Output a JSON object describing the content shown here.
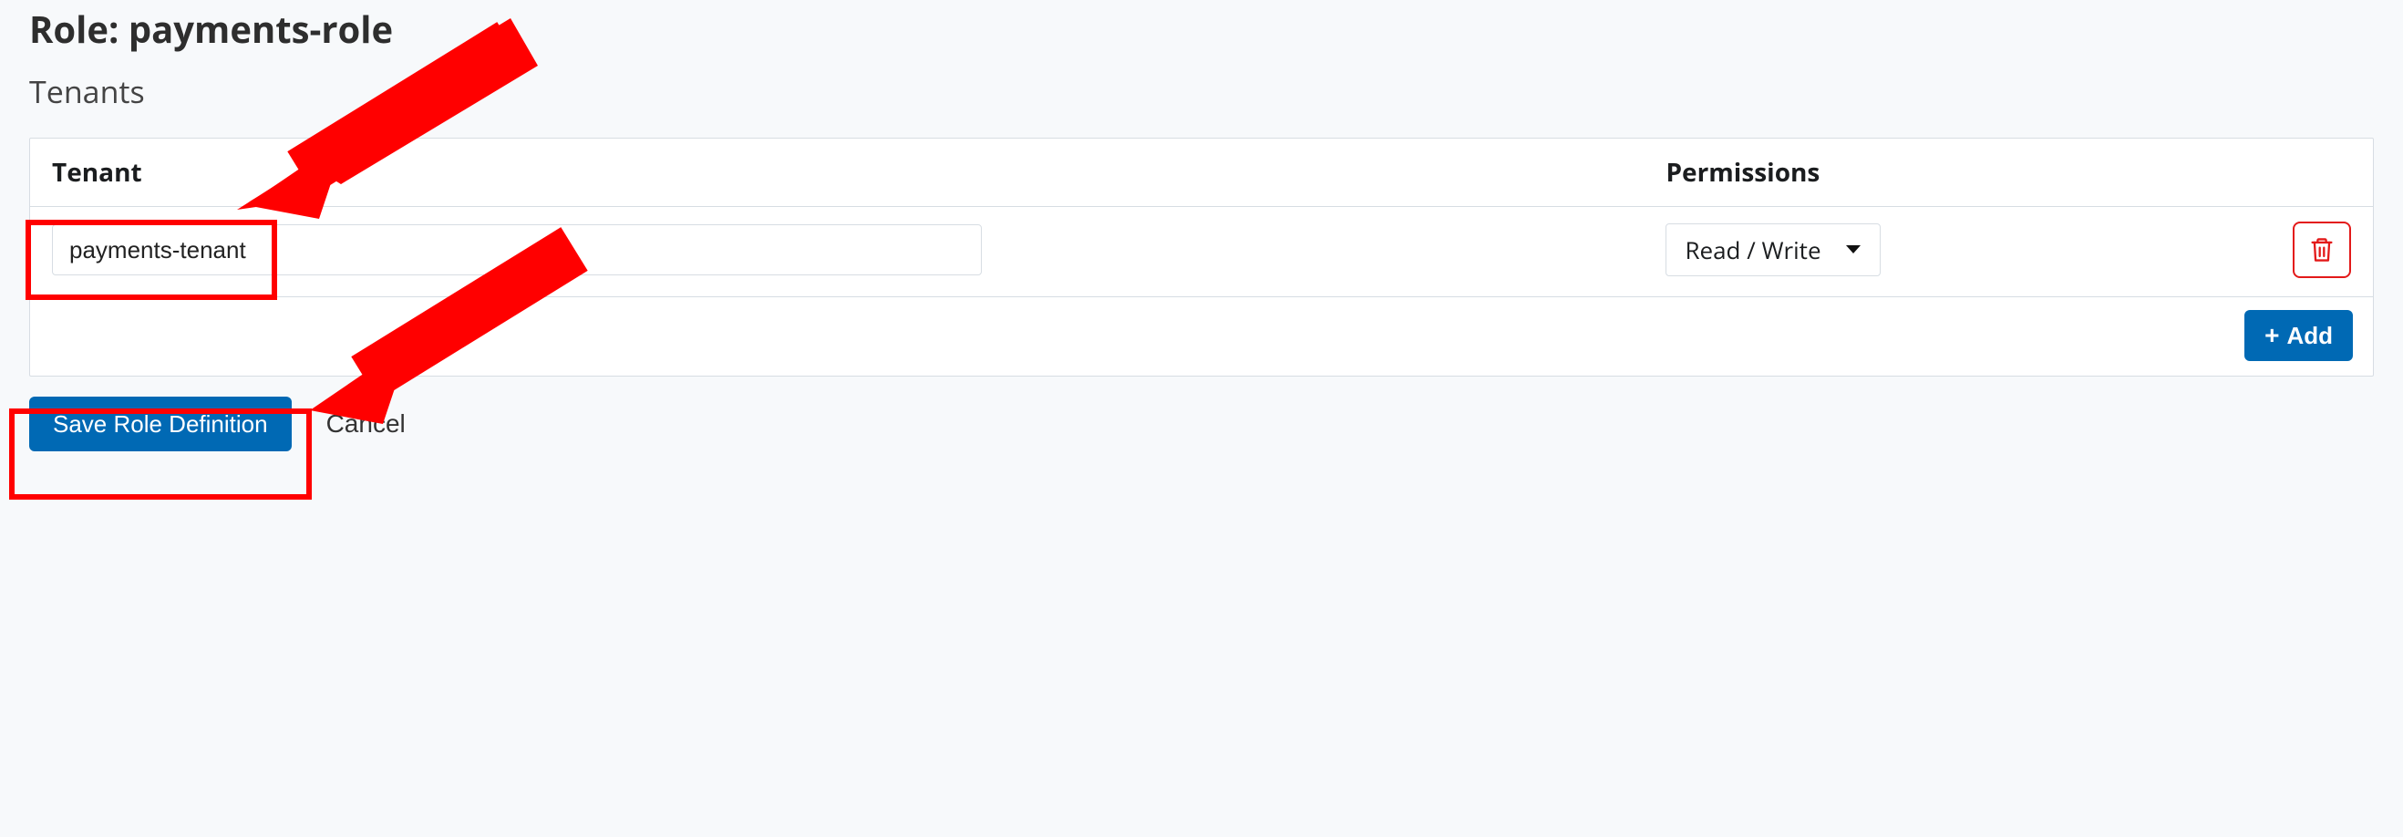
{
  "page": {
    "title_prefix": "Role: ",
    "role_name": "payments-role",
    "section_title": "Tenants"
  },
  "table": {
    "header_tenant": "Tenant",
    "header_permissions": "Permissions",
    "rows": [
      {
        "tenant": "payments-tenant",
        "permission": "Read / Write"
      }
    ],
    "add_label": "Add"
  },
  "actions": {
    "save_label": "Save Role Definition",
    "cancel_label": "Cancel"
  },
  "colors": {
    "primary": "#0069b4",
    "danger": "#e31919",
    "annotation": "#ff0000"
  }
}
